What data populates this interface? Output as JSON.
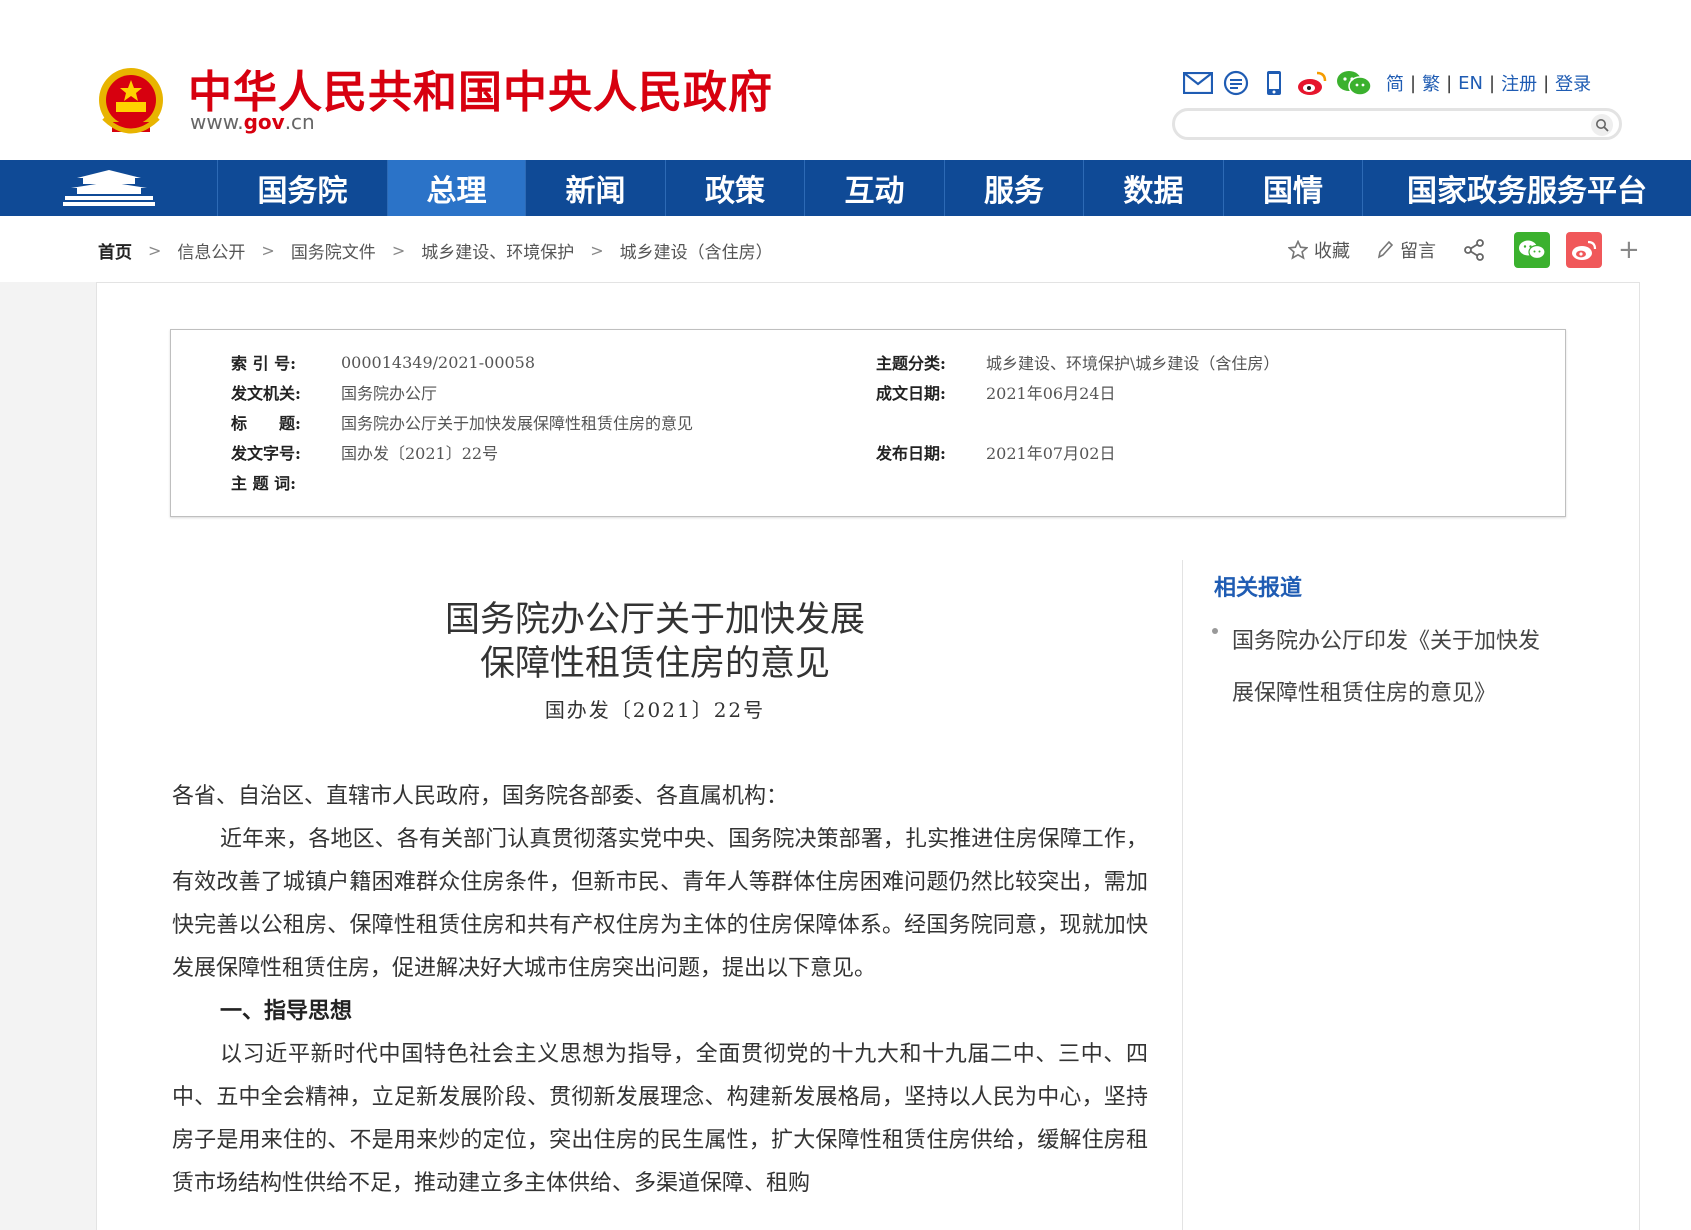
{
  "header": {
    "site_title": "中华人民共和国中央人民政府",
    "site_url_prefix": "www.",
    "site_url_domain": "gov",
    "site_url_suffix": ".cn",
    "tool_icons": [
      "mail-icon",
      "message-icon",
      "mobile-icon",
      "weibo-icon",
      "wechat-icon"
    ],
    "lang_links": [
      "简",
      "繁",
      "EN",
      "注册",
      "登录"
    ],
    "search_placeholder": ""
  },
  "nav": {
    "items": [
      "国务院",
      "总理",
      "新闻",
      "政策",
      "互动",
      "服务",
      "数据",
      "国情",
      "国家政务服务平台"
    ],
    "active_index": 1
  },
  "breadcrumb": [
    "首页",
    "信息公开",
    "国务院文件",
    "城乡建设、环境保护",
    "城乡建设（含住房）"
  ],
  "share": {
    "favorite_label": "收藏",
    "comment_label": "留言"
  },
  "meta": {
    "index_label": "索 引 号:",
    "index_value": "000014349/2021-00058",
    "category_label": "主题分类:",
    "category_value": "城乡建设、环境保护\\城乡建设（含住房）",
    "issuer_label": "发文机关:",
    "issuer_value": "国务院办公厅",
    "created_label": "成文日期:",
    "created_value": "2021年06月24日",
    "title_label": "标　　题:",
    "title_value": "国务院办公厅关于加快发展保障性租赁住房的意见",
    "docno_label": "发文字号:",
    "docno_value": "国办发〔2021〕22号",
    "published_label": "发布日期:",
    "published_value": "2021年07月02日",
    "keywords_label": "主 题 词:",
    "keywords_value": ""
  },
  "article": {
    "title_line1": "国务院办公厅关于加快发展",
    "title_line2": "保障性租赁住房的意见",
    "doc_number": "国办发〔2021〕22号",
    "salutation": "各省、自治区、直辖市人民政府，国务院各部委、各直属机构：",
    "para1": "近年来，各地区、各有关部门认真贯彻落实党中央、国务院决策部署，扎实推进住房保障工作，有效改善了城镇户籍困难群众住房条件，但新市民、青年人等群体住房困难问题仍然比较突出，需加快完善以公租房、保障性租赁住房和共有产权住房为主体的住房保障体系。经国务院同意，现就加快发展保障性租赁住房，促进解决好大城市住房突出问题，提出以下意见。",
    "heading1": "一、指导思想",
    "para2": "以习近平新时代中国特色社会主义思想为指导，全面贯彻党的十九大和十九届二中、三中、四中、五中全会精神，立足新发展阶段、贯彻新发展理念、构建新发展格局，坚持以人民为中心，坚持房子是用来住的、不是用来炒的定位，突出住房的民生属性，扩大保障性租赁住房供给，缓解住房租赁市场结构性供给不足，推动建立多主体供给、多渠道保障、租购"
  },
  "sidebar": {
    "title": "相关报道",
    "items": [
      "国务院办公厅印发《关于加快发展保障性租赁住房的意见》"
    ]
  },
  "colors": {
    "brand_red": "#d7000f",
    "nav_blue": "#0f4a96",
    "nav_active": "#2b73c8",
    "link_blue": "#1f5cb3"
  }
}
